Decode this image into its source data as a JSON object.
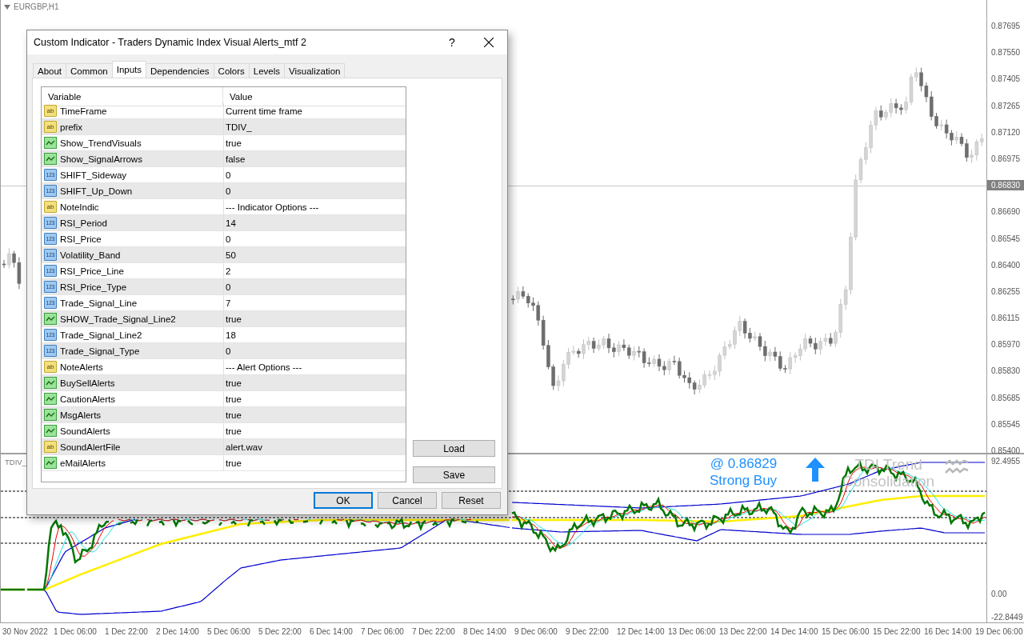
{
  "chart": {
    "symbol": "EURGBP,H1",
    "price_labels": [
      {
        "text": "0.87695",
        "current": false
      },
      {
        "text": "0.87550",
        "current": false
      },
      {
        "text": "0.87405",
        "current": false
      },
      {
        "text": "0.87265",
        "current": false
      },
      {
        "text": "0.87120",
        "current": false
      },
      {
        "text": "0.86975",
        "current": false
      },
      {
        "text": "0.86830",
        "current": true
      },
      {
        "text": "0.86690",
        "current": false
      },
      {
        "text": "0.86545",
        "current": false
      },
      {
        "text": "0.86400",
        "current": false
      },
      {
        "text": "0.86255",
        "current": false
      },
      {
        "text": "0.86115",
        "current": false
      },
      {
        "text": "0.85970",
        "current": false
      },
      {
        "text": "0.85830",
        "current": false
      },
      {
        "text": "0.85685",
        "current": false
      },
      {
        "text": "0.85545",
        "current": false
      },
      {
        "text": "0.85400",
        "current": false
      }
    ],
    "indicator": {
      "name": "TDIV_",
      "axis_labels": [
        "92.4955",
        "0.00",
        "-22.8449"
      ],
      "signal": {
        "price": "@ 0.86829",
        "label": "Strong Buy"
      },
      "trend": [
        "TDI Trend",
        "Consolidation"
      ]
    },
    "time_labels": [
      "30 Nov 2022",
      "1 Dec 06:00",
      "1 Dec 22:00",
      "2 Dec 14:00",
      "5 Dec 06:00",
      "5 Dec 22:00",
      "6 Dec 14:00",
      "7 Dec 06:00",
      "7 Dec 22:00",
      "8 Dec 14:00",
      "9 Dec 06:00",
      "9 Dec 22:00",
      "12 Dec 14:00",
      "13 Dec 06:00",
      "13 Dec 22:00",
      "14 Dec 14:00",
      "15 Dec 06:00",
      "15 Dec 22:00",
      "16 Dec 14:00",
      "19 Dec 06:00"
    ]
  },
  "dialog": {
    "title": "Custom Indicator - Traders Dynamic Index Visual Alerts_mtf 2",
    "help": "?",
    "tabs": [
      {
        "label": "About",
        "selected": false
      },
      {
        "label": "Common",
        "selected": false
      },
      {
        "label": "Inputs",
        "selected": true
      },
      {
        "label": "Dependencies",
        "selected": false
      },
      {
        "label": "Colors",
        "selected": false
      },
      {
        "label": "Levels",
        "selected": false
      },
      {
        "label": "Visualization",
        "selected": false
      }
    ],
    "columns": [
      "Variable",
      "Value"
    ],
    "rows": [
      {
        "variable": "TimeFrame",
        "value": "Current time frame",
        "kind": "string",
        "badge": "ab"
      },
      {
        "variable": "prefix",
        "value": "TDIV_",
        "kind": "string",
        "badge": "ab"
      },
      {
        "variable": "Show_TrendVisuals",
        "value": "true",
        "kind": "bool"
      },
      {
        "variable": "Show_SignalArrows",
        "value": "false",
        "kind": "bool"
      },
      {
        "variable": "SHIFT_Sideway",
        "value": "0",
        "kind": "int",
        "badge": "123"
      },
      {
        "variable": "SHIFT_Up_Down",
        "value": "0",
        "kind": "int",
        "badge": "123"
      },
      {
        "variable": "NoteIndic",
        "value": "--- Indicator Options ---",
        "kind": "string",
        "badge": "ab"
      },
      {
        "variable": "RSI_Period",
        "value": "14",
        "kind": "int",
        "badge": "123"
      },
      {
        "variable": "RSI_Price",
        "value": "0",
        "kind": "int",
        "badge": "123"
      },
      {
        "variable": "Volatility_Band",
        "value": "50",
        "kind": "int",
        "badge": "123"
      },
      {
        "variable": "RSI_Price_Line",
        "value": "2",
        "kind": "int",
        "badge": "123"
      },
      {
        "variable": "RSI_Price_Type",
        "value": "0",
        "kind": "int",
        "badge": "123"
      },
      {
        "variable": "Trade_Signal_Line",
        "value": "7",
        "kind": "int",
        "badge": "123"
      },
      {
        "variable": "SHOW_Trade_Signal_Line2",
        "value": "true",
        "kind": "bool"
      },
      {
        "variable": "Trade_Signal_Line2",
        "value": "18",
        "kind": "int",
        "badge": "123"
      },
      {
        "variable": "Trade_Signal_Type",
        "value": "0",
        "kind": "int",
        "badge": "123"
      },
      {
        "variable": "NoteAlerts",
        "value": "--- Alert Options ---",
        "kind": "string",
        "badge": "ab"
      },
      {
        "variable": "BuySellAlerts",
        "value": "true",
        "kind": "bool"
      },
      {
        "variable": "CautionAlerts",
        "value": "true",
        "kind": "bool"
      },
      {
        "variable": "MsgAlerts",
        "value": "true",
        "kind": "bool"
      },
      {
        "variable": "SoundAlerts",
        "value": "true",
        "kind": "bool"
      },
      {
        "variable": "SoundAlertFile",
        "value": "alert.wav",
        "kind": "string",
        "badge": "ab"
      },
      {
        "variable": "eMailAlerts",
        "value": "true",
        "kind": "bool"
      }
    ],
    "side_buttons": [
      "Load",
      "Save"
    ],
    "buttons": [
      {
        "label": "OK",
        "default": true
      },
      {
        "label": "Cancel",
        "default": false
      },
      {
        "label": "Reset",
        "default": false
      }
    ]
  }
}
